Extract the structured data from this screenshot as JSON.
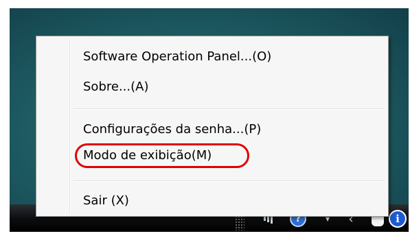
{
  "context_menu": {
    "items": [
      {
        "label": "Software Operation Panel...(O)"
      },
      {
        "label": "Sobre...(A)"
      },
      {
        "label": "Configurações da senha...(P)"
      },
      {
        "label": "Modo de exibição(M)",
        "highlighted": true
      },
      {
        "label": "Sair (X)"
      }
    ]
  },
  "colors": {
    "highlight_outline": "#e00000",
    "desktop": "#1f5f66",
    "taskbar": "#0c0e10"
  },
  "tray_icons": [
    "network-icon",
    "help-icon",
    "show-hidden-icons-arrow",
    "volume-icon",
    "scanner-hand-icon",
    "info-icon"
  ]
}
